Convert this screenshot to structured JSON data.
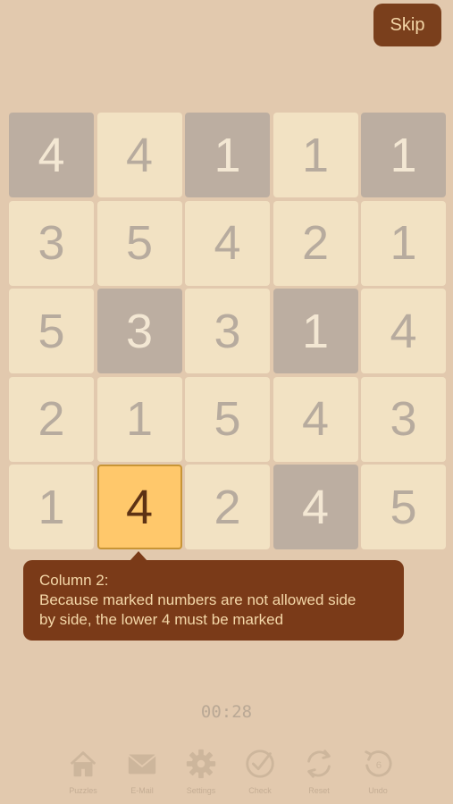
{
  "header": {
    "skip_label": "Skip"
  },
  "grid": {
    "rows": [
      [
        "4",
        "4",
        "1",
        "1",
        "1"
      ],
      [
        "3",
        "5",
        "4",
        "2",
        "1"
      ],
      [
        "5",
        "3",
        "3",
        "1",
        "4"
      ],
      [
        "2",
        "1",
        "5",
        "4",
        "3"
      ],
      [
        "1",
        "4",
        "2",
        "4",
        "5"
      ]
    ],
    "shaded": [
      [
        0,
        0
      ],
      [
        0,
        2
      ],
      [
        0,
        4
      ],
      [
        2,
        1
      ],
      [
        2,
        3
      ],
      [
        4,
        3
      ]
    ],
    "highlighted": [
      [
        4,
        1
      ]
    ]
  },
  "hint": {
    "title": "Column 2:",
    "line1": "Because marked numbers are not allowed side",
    "line2": "by side, the lower 4 must be marked"
  },
  "timer": "00:28",
  "toolbar": {
    "items": [
      {
        "label": "Puzzles",
        "icon": "home-icon"
      },
      {
        "label": "E-Mail",
        "icon": "mail-icon"
      },
      {
        "label": "Settings",
        "icon": "gear-icon"
      },
      {
        "label": "Check",
        "icon": "check-icon"
      },
      {
        "label": "Reset",
        "icon": "reset-icon"
      },
      {
        "label": "Undo",
        "icon": "undo-icon",
        "badge": "6"
      }
    ]
  },
  "colors": {
    "background": "#e2c9ae",
    "cell": "#f2e2c3",
    "shaded": "#bcaea1",
    "highlight": "#ffc86b",
    "accent": "#7a3a18"
  }
}
